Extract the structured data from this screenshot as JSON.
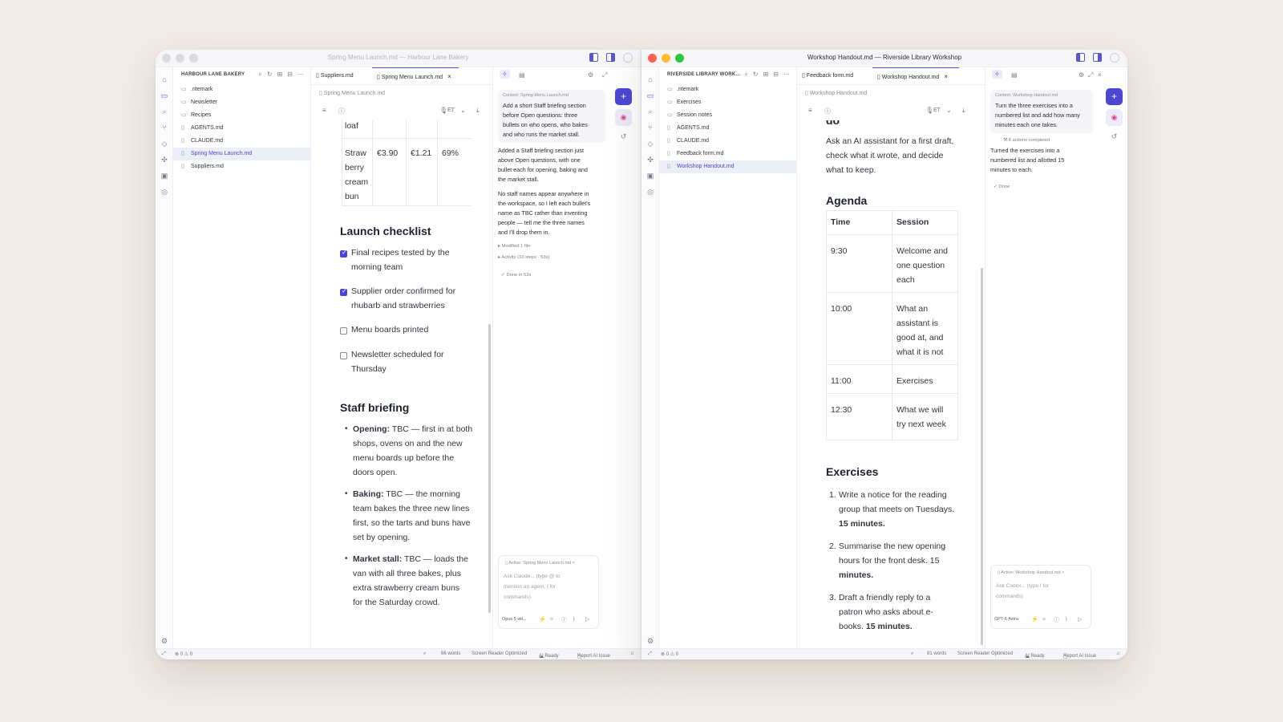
{
  "left": {
    "title": "Spring Menu Launch.md — Harbour Lane Bakery",
    "explorer": {
      "header": "HARBOUR LANE BAKERY",
      "items": [
        {
          "label": ".ritemark",
          "icon": "folder-icon"
        },
        {
          "label": "Newsletter",
          "icon": "folder-icon"
        },
        {
          "label": "Recipes",
          "icon": "folder-icon"
        },
        {
          "label": "AGENTS.md",
          "icon": "file-icon"
        },
        {
          "label": "CLAUDE.md",
          "icon": "file-icon"
        },
        {
          "label": "Spring Menu Launch.md",
          "icon": "file-icon"
        },
        {
          "label": "Suppliers.md",
          "icon": "file-icon"
        }
      ]
    },
    "tabs": [
      "Suppliers.md",
      "Spring Menu Launch.md"
    ],
    "breadcrumb": "Spring Menu Launch.md",
    "toolbar": {
      "lang": "ET"
    },
    "doc": {
      "table_tail": [
        "loaf"
      ],
      "table_row": {
        "item_lines": [
          "Straw",
          "berry",
          "cream",
          "bun"
        ],
        "price": "€3.90",
        "cost": "€1.21",
        "margin": "69%"
      },
      "checklist_heading": "Launch checklist",
      "checklist": [
        {
          "lines": [
            "Final recipes tested by the",
            "morning team"
          ],
          "checked": true
        },
        {
          "lines": [
            "Supplier order confirmed for",
            "rhubarb and strawberries"
          ],
          "checked": true
        },
        {
          "lines": [
            "Menu boards printed"
          ],
          "checked": false
        },
        {
          "lines": [
            "Newsletter scheduled for",
            "Thursday"
          ],
          "checked": false
        }
      ],
      "briefing_heading": "Staff briefing",
      "briefing": [
        {
          "bold": "Opening:",
          "lines": [
            " TBC — first in at both",
            "shops, ovens on and the new",
            "menu boards up before the",
            "doors open."
          ]
        },
        {
          "bold": "Baking:",
          "lines": [
            " TBC — the morning",
            "team bakes the three new lines",
            "first, so the tarts and buns have",
            "set by opening."
          ]
        },
        {
          "bold": "Market stall:",
          "lines": [
            " TBC — loads the",
            "van with all three bakes, plus",
            "extra strawberry cream buns",
            "for the Saturday crowd."
          ]
        }
      ]
    },
    "chat": {
      "context": "Context: Spring Menu Launch.md",
      "request_lines": [
        "Add a short Staff briefing section",
        "before Open questions: three",
        "bullets on who opens, who bakes",
        "and who runs the market stall."
      ],
      "response1_lines": [
        "Added a Staff briefing section just",
        "above Open questions, with one",
        "bullet each for opening, baking and",
        "the market stall."
      ],
      "response2_lines": [
        "No staff names appear anywhere in",
        "the workspace, so I left each bullet's",
        "name as TBC rather than inventing",
        "people — tell me the three names",
        "and I'll drop them in."
      ],
      "modified": "▸ Modified 1 file",
      "activity": "▸ Activity (10 steps · 53s)",
      "done": "Done in 53s",
      "composer_active": "Active: Spring Menu Launch.md",
      "composer_placeholder_lines": [
        "Ask Claude... (type @ to",
        "mention an agent, / for",
        "commands)"
      ],
      "model": "Opus 5 wit..."
    },
    "status": {
      "problems": "⊗ 0 ⚠ 0",
      "words": "66 words",
      "sr": "Screen Reader Optimized",
      "ai": "AI Ready",
      "report": "Report AI Issue"
    }
  },
  "right": {
    "title": "Workshop Handout.md — Riverside Library Workshop",
    "explorer": {
      "header": "RIVERSIDE LIBRARY WORK...",
      "items": [
        {
          "label": ".ritemark",
          "icon": "folder-icon"
        },
        {
          "label": "Exercises",
          "icon": "folder-icon"
        },
        {
          "label": "Session notes",
          "icon": "folder-icon"
        },
        {
          "label": "AGENTS.md",
          "icon": "file-icon"
        },
        {
          "label": "CLAUDE.md",
          "icon": "file-icon"
        },
        {
          "label": "Feedback form.md",
          "icon": "file-icon"
        },
        {
          "label": "Workshop Handout.md",
          "icon": "file-icon"
        }
      ]
    },
    "tabs": [
      "Feedback form.md",
      "Workshop Handout.md"
    ],
    "breadcrumb": "Workshop Handout.md",
    "toolbar": {
      "lang": "ET"
    },
    "doc": {
      "top_word": "do",
      "intro_lines": [
        "Ask an AI assistant for a first draft,",
        "check what it wrote, and decide",
        "what to keep."
      ],
      "agenda_heading": "Agenda",
      "agenda_headers": [
        "Time",
        "Session"
      ],
      "agenda": [
        {
          "time": "9:30",
          "lines": [
            "Welcome and",
            "one question",
            "each"
          ]
        },
        {
          "time": "10:00",
          "lines": [
            "What an",
            "assistant is",
            "good at, and",
            "what it is not"
          ]
        },
        {
          "time": "11:00",
          "lines": [
            "Exercises"
          ]
        },
        {
          "time": "12:30",
          "lines": [
            "What we will",
            "try next week"
          ]
        }
      ],
      "exercises_heading": "Exercises",
      "exercises": [
        {
          "num": "1.",
          "lines": [
            "Write a notice for the reading",
            "group that meets on Tuesdays."
          ],
          "bold": "15 minutes."
        },
        {
          "num": "2.",
          "lines": [
            "Summarise the new opening",
            "hours for the front desk. 15"
          ],
          "bold": "minutes."
        },
        {
          "num": "3.",
          "lines": [
            "Draft a friendly reply to a",
            "patron who asks about e-",
            "books."
          ],
          "bold": "15 minutes."
        }
      ]
    },
    "chat": {
      "context": "Context: Workshop Handout.md",
      "request_lines": [
        "Turn the three exercises into a",
        "numbered list and add how many",
        "minutes each one takes."
      ],
      "actions": "6 actions completed",
      "response_lines": [
        "Turned the exercises into a",
        "numbered list and allotted 15",
        "minutes to each."
      ],
      "done": "Done",
      "composer_active": "Active: Workshop Handout.md",
      "composer_placeholder_lines": [
        "Ask Codex... (type / for",
        "commands)"
      ],
      "model": "GPT-6 Astra"
    },
    "status": {
      "problems": "⊗ 0 ⚠ 0",
      "words": "81 words",
      "sr": "Screen Reader Optimized",
      "ai": "AI Ready",
      "report": "Report AI Issue"
    }
  },
  "colors": {
    "accent": "#4b47d6",
    "close": "#ff5f57",
    "minimize": "#febc2e",
    "zoom": "#28c840",
    "inactive_light": "#dcdce0"
  }
}
